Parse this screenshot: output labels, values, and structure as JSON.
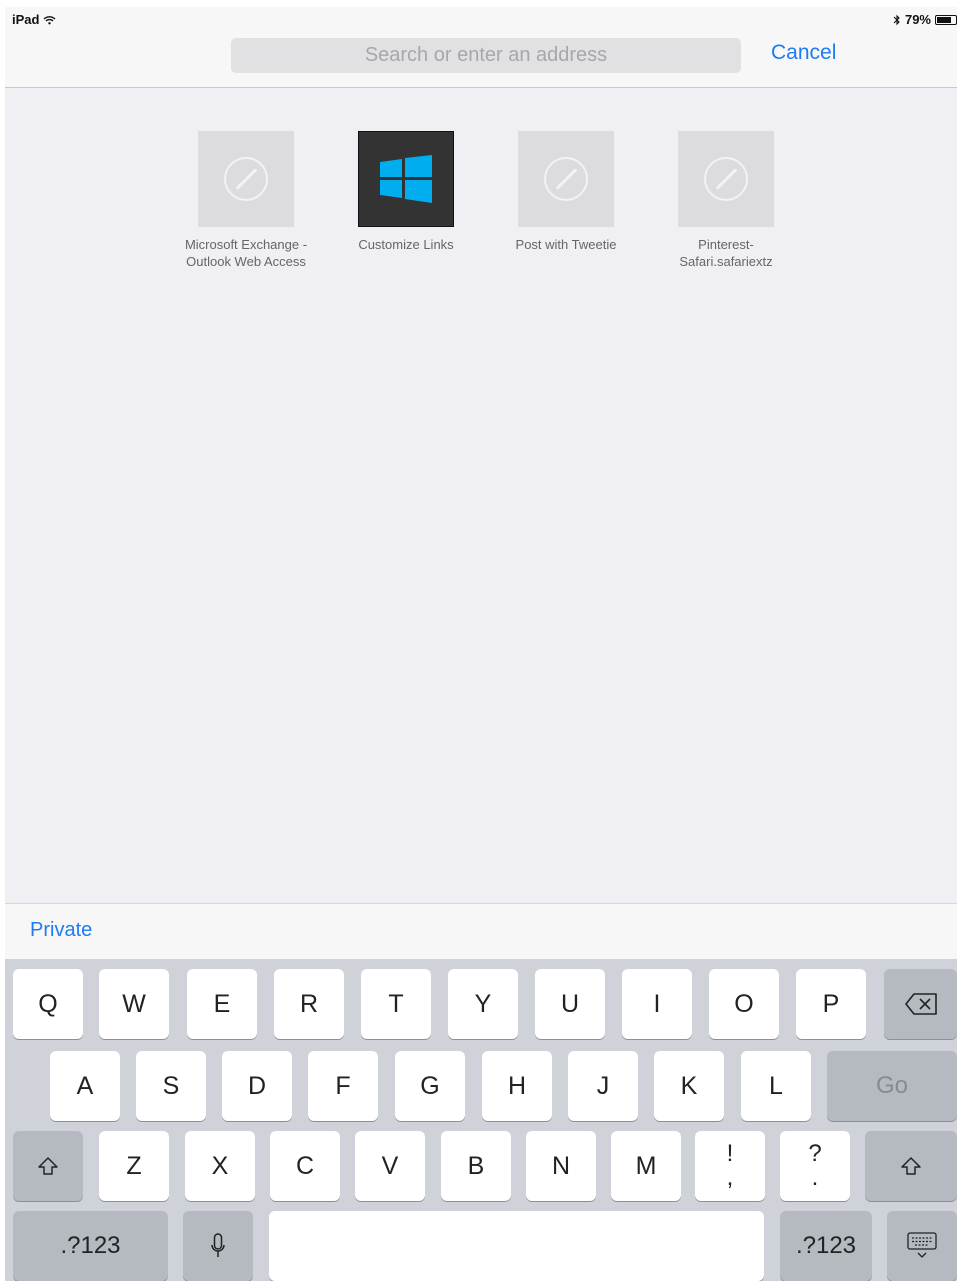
{
  "status": {
    "device": "iPad",
    "wifi_icon": "wifi-icon",
    "bluetooth_icon": "bluetooth-icon",
    "battery": "79%"
  },
  "search": {
    "placeholder": "Search or enter an address",
    "value": ""
  },
  "cancel_label": "Cancel",
  "favorites": [
    {
      "line1": "Microsoft Exchange -",
      "line2": "Outlook Web Access",
      "icon": "compass-icon"
    },
    {
      "line1": "Customize Links",
      "line2": "",
      "icon": "windows-logo-icon"
    },
    {
      "line1": "Post with Tweetie",
      "line2": "",
      "icon": "compass-icon"
    },
    {
      "line1": "Pinterest-",
      "line2": "Safari.safariextz",
      "icon": "compass-icon"
    }
  ],
  "private_label": "Private",
  "keyboard": {
    "row1": [
      "Q",
      "W",
      "E",
      "R",
      "T",
      "Y",
      "U",
      "I",
      "O",
      "P"
    ],
    "row2": [
      "A",
      "S",
      "D",
      "F",
      "G",
      "H",
      "J",
      "K",
      "L"
    ],
    "row3": [
      "Z",
      "X",
      "C",
      "V",
      "B",
      "N",
      "M"
    ],
    "excl": {
      "top": "!",
      "bottom": ","
    },
    "question": {
      "top": "?",
      "bottom": "."
    },
    "go_label": "Go",
    "numbers_label": ".?123",
    "icons": {
      "backspace": "backspace-icon",
      "shift": "shift-icon",
      "mic": "microphone-icon",
      "dismiss": "keyboard-dismiss-icon"
    }
  },
  "colors": {
    "accent": "#1e7cf2",
    "windows_blue": "#00adef",
    "keyboard_bg": "#cfd2d8"
  }
}
